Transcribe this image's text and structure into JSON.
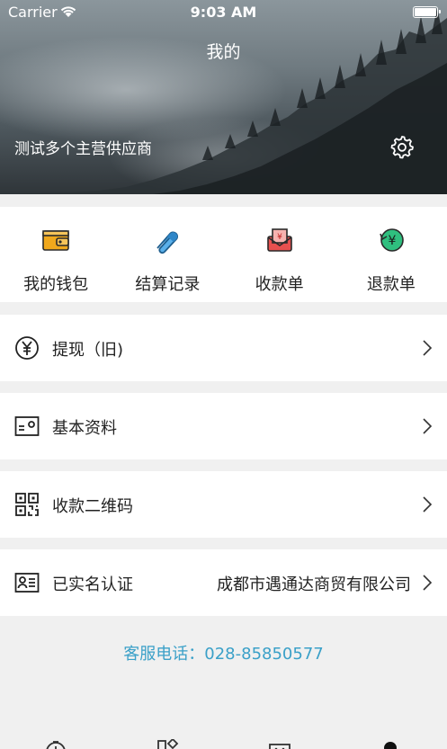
{
  "status_bar": {
    "carrier": "Carrier",
    "time": "9:03 AM"
  },
  "header": {
    "title": "我的",
    "merchant_name": "测试多个主营供应商"
  },
  "quick_actions": [
    {
      "label": "我的钱包",
      "icon": "wallet-icon"
    },
    {
      "label": "结算记录",
      "icon": "paperclip-icon"
    },
    {
      "label": "收款单",
      "icon": "receipt-envelope-icon"
    },
    {
      "label": "退款单",
      "icon": "refund-yen-icon"
    }
  ],
  "menu": {
    "withdraw": {
      "label": "提现（旧)",
      "icon": "yen-circle-icon"
    },
    "profile": {
      "label": "基本资料",
      "icon": "id-card-icon"
    },
    "qrcode": {
      "label": "收款二维码",
      "icon": "qr-code-icon"
    },
    "verification": {
      "label": "已实名认证",
      "value": "成都市遇通达商贸有限公司",
      "icon": "contact-card-icon"
    }
  },
  "service": {
    "text": "客服电话：028-85850577"
  },
  "colors": {
    "accent": "#3aa0c8",
    "wallet": "#f0a81c",
    "clip": "#2e86c8",
    "envelope": "#e8504f",
    "refund": "#2fbf7f"
  }
}
